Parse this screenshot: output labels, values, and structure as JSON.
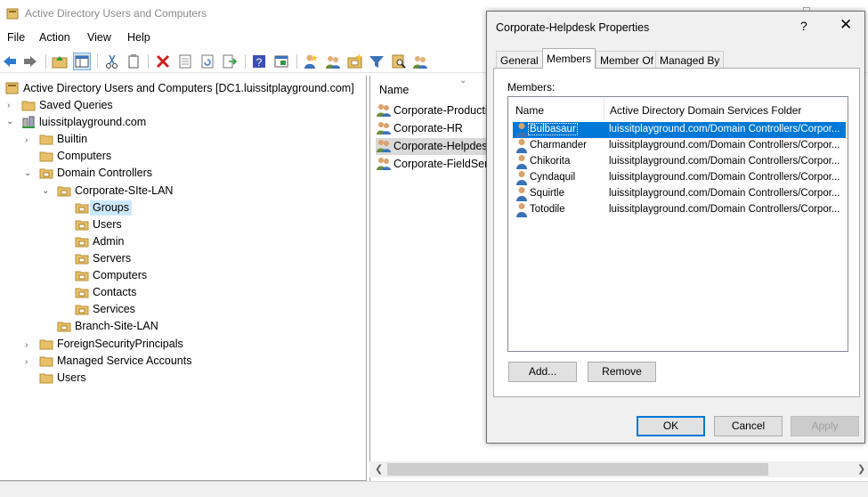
{
  "main_window": {
    "title": "Active Directory Users and Computers",
    "window_controls": {
      "maximize": "□"
    }
  },
  "menu": [
    "File",
    "Action",
    "View",
    "Help"
  ],
  "toolbar_icons": [
    "back-icon",
    "forward-icon",
    "up-folder-icon",
    "show-hide-tree-icon",
    "cut-icon",
    "copy-icon",
    "delete-icon",
    "properties-icon",
    "refresh-icon",
    "export-icon",
    "help-icon",
    "console-icon",
    "new-user-icon",
    "new-group-icon",
    "new-ou-icon",
    "filter-icon",
    "find-icon",
    "add-to-group-icon"
  ],
  "tree": {
    "root": "Active Directory Users and Computers [DC1.luissitplayground.com]",
    "items": [
      {
        "label": "Saved Queries"
      },
      {
        "label": "luissitplayground.com"
      },
      {
        "label": "Builtin"
      },
      {
        "label": "Computers"
      },
      {
        "label": "Domain Controllers"
      },
      {
        "label": "Corporate-SIte-LAN"
      },
      {
        "label": "Groups"
      },
      {
        "label": "Users"
      },
      {
        "label": "Admin"
      },
      {
        "label": "Servers"
      },
      {
        "label": "Computers"
      },
      {
        "label": "Contacts"
      },
      {
        "label": "Services"
      },
      {
        "label": "Branch-Site-LAN"
      },
      {
        "label": "ForeignSecurityPrincipals"
      },
      {
        "label": "Managed Service Accounts"
      },
      {
        "label": "Users"
      }
    ]
  },
  "list": {
    "column_name": "Name",
    "items": [
      {
        "label": "Corporate-Production"
      },
      {
        "label": "Corporate-HR"
      },
      {
        "label": "Corporate-Helpdesk"
      },
      {
        "label": "Corporate-FieldService"
      }
    ]
  },
  "dialog": {
    "title": "Corporate-Helpdesk Properties",
    "help_glyph": "?",
    "close_glyph": "✕",
    "tabs": [
      "General",
      "Members",
      "Member Of",
      "Managed By"
    ],
    "active_tab": "Members",
    "members_label": "Members:",
    "columns": [
      "Name",
      "Active Directory Domain Services Folder"
    ],
    "members": [
      {
        "name": "Bulbasaur",
        "folder": "luissitplayground.com/Domain Controllers/Corpor..."
      },
      {
        "name": "Charmander",
        "folder": "luissitplayground.com/Domain Controllers/Corpor..."
      },
      {
        "name": "Chikorita",
        "folder": "luissitplayground.com/Domain Controllers/Corpor..."
      },
      {
        "name": "Cyndaquil",
        "folder": "luissitplayground.com/Domain Controllers/Corpor..."
      },
      {
        "name": "Squirtle",
        "folder": "luissitplayground.com/Domain Controllers/Corpor..."
      },
      {
        "name": "Totodile",
        "folder": "luissitplayground.com/Domain Controllers/Corpor..."
      }
    ],
    "buttons": {
      "add": "Add...",
      "remove": "Remove",
      "ok": "OK",
      "cancel": "Cancel",
      "apply": "Apply"
    }
  },
  "colors": {
    "selection": "#0078d7",
    "tree_selection": "#cce8ff",
    "folder": "#e8c06a"
  }
}
